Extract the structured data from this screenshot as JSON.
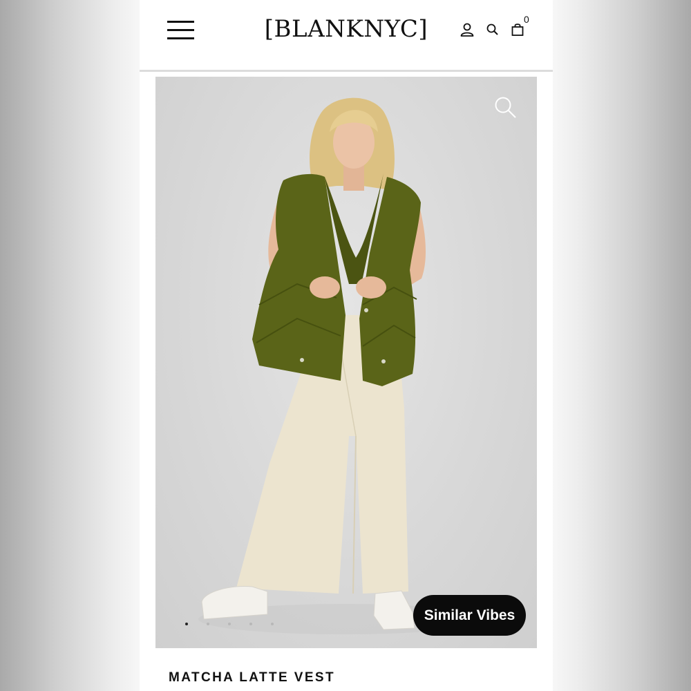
{
  "brand": {
    "logo_text": "[BLANKNYC]"
  },
  "header": {
    "menu_icon": "hamburger-menu-icon",
    "account_icon": "user-icon",
    "search_icon": "search-icon",
    "cart_icon": "bag-icon",
    "cart_count": "0"
  },
  "gallery": {
    "zoom_icon": "magnifier-icon",
    "similar_button_label": "Similar Vibes",
    "slide_count": 5,
    "active_slide": 1
  },
  "product": {
    "title": "MATCHA LATTE VEST"
  },
  "colors": {
    "vest": "#5a6418",
    "pants": "#ece4cf",
    "hair": "#e2c78a",
    "skin": "#e6b99a",
    "shoes": "#f3f1ec",
    "pill": "#0b0b0b"
  }
}
